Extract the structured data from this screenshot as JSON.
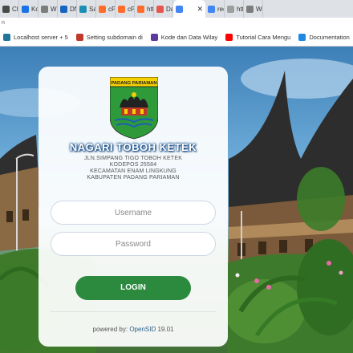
{
  "browser": {
    "tabs": [
      {
        "label": "Clie",
        "color": "#4a4a4a"
      },
      {
        "label": "Ko",
        "color": "#1a73e8"
      },
      {
        "label": "Wh",
        "color": "#7d7d7d"
      },
      {
        "label": "DN",
        "color": "#1565c0"
      },
      {
        "label": "Sar",
        "color": "#1a8fb3"
      },
      {
        "label": "cPa",
        "color": "#ff6c2c"
      },
      {
        "label": "cPa",
        "color": "#ff6c2c"
      },
      {
        "label": "htt",
        "color": "#ff6c2c"
      },
      {
        "label": "Dat",
        "color": "#e6564e"
      },
      {
        "label": "",
        "color": "#4285f4",
        "active": true
      },
      {
        "label": "red",
        "color": "#4285f4"
      },
      {
        "label": "htt",
        "color": "#9e9e9e"
      },
      {
        "label": "We",
        "color": "#7d7d7d"
      }
    ],
    "url_fragment": "n",
    "bookmarks": [
      {
        "label": "Localhost server + 5",
        "icon": "wordpress-icon",
        "color": "#21759b"
      },
      {
        "label": "Setting subdomain di",
        "icon": "grid-icon",
        "color": "#c0392b"
      },
      {
        "label": "Kode dan Data Wilay",
        "icon": "shield-icon",
        "color": "#5c3a9e"
      },
      {
        "label": "Tutorial Cara Mengu",
        "icon": "youtube-icon",
        "color": "#ff0000"
      },
      {
        "label": "Documentation",
        "icon": "docs-icon",
        "color": "#1e88e5"
      }
    ]
  },
  "login": {
    "logo_text": "PADANG PARIAMAN",
    "title": "NAGARI TOBOH KETEK",
    "address": [
      "JLN.SIMPANG TIGO TOBOH KETEK",
      "KODEPOS 25584",
      "KECAMATAN ENAM LINGKUNG",
      "KABUPATEN PADANG PARIAMAN"
    ],
    "username_placeholder": "Username",
    "password_placeholder": "Password",
    "login_label": "LOGIN",
    "powered_prefix": "powered by:",
    "powered_brand": "OpenSID",
    "powered_version": "19.01"
  },
  "colors": {
    "accent_green": "#2b8a3e",
    "title_blue": "#0b4a8a"
  }
}
